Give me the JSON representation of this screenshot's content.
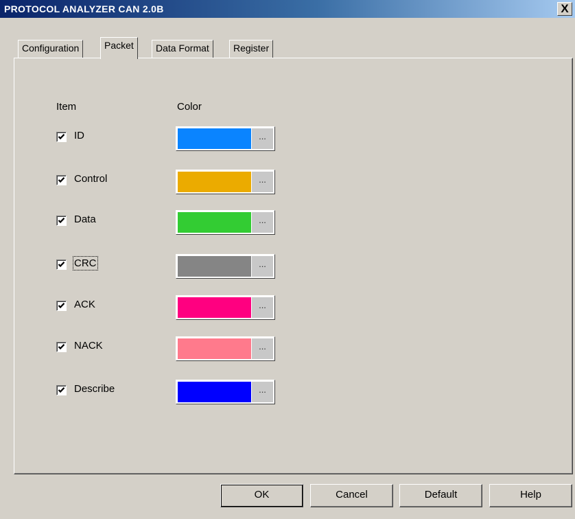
{
  "window": {
    "title": "PROTOCOL ANALYZER CAN 2.0B",
    "close_glyph": "X"
  },
  "tabs": [
    {
      "label": "Configuration",
      "active": false
    },
    {
      "label": "Packet",
      "active": true
    },
    {
      "label": "Data Format",
      "active": false
    },
    {
      "label": "Register",
      "active": false
    }
  ],
  "headers": {
    "item": "Item",
    "color": "Color"
  },
  "items": [
    {
      "label": "ID",
      "checked": true,
      "color": "#0a84ff",
      "button": "..."
    },
    {
      "label": "Control",
      "checked": true,
      "color": "#ebab00",
      "button": "..."
    },
    {
      "label": "Data",
      "checked": true,
      "color": "#33cc33",
      "button": "..."
    },
    {
      "label": "CRC",
      "checked": true,
      "color": "#858585",
      "button": "..."
    },
    {
      "label": "ACK",
      "checked": true,
      "color": "#ff0080",
      "button": "..."
    },
    {
      "label": "NACK",
      "checked": true,
      "color": "#ff7a8c",
      "button": "..."
    },
    {
      "label": "Describe",
      "checked": true,
      "color": "#0000ff",
      "button": "..."
    }
  ],
  "buttons": {
    "ok": "OK",
    "cancel": "Cancel",
    "default": "Default",
    "help": "Help"
  }
}
